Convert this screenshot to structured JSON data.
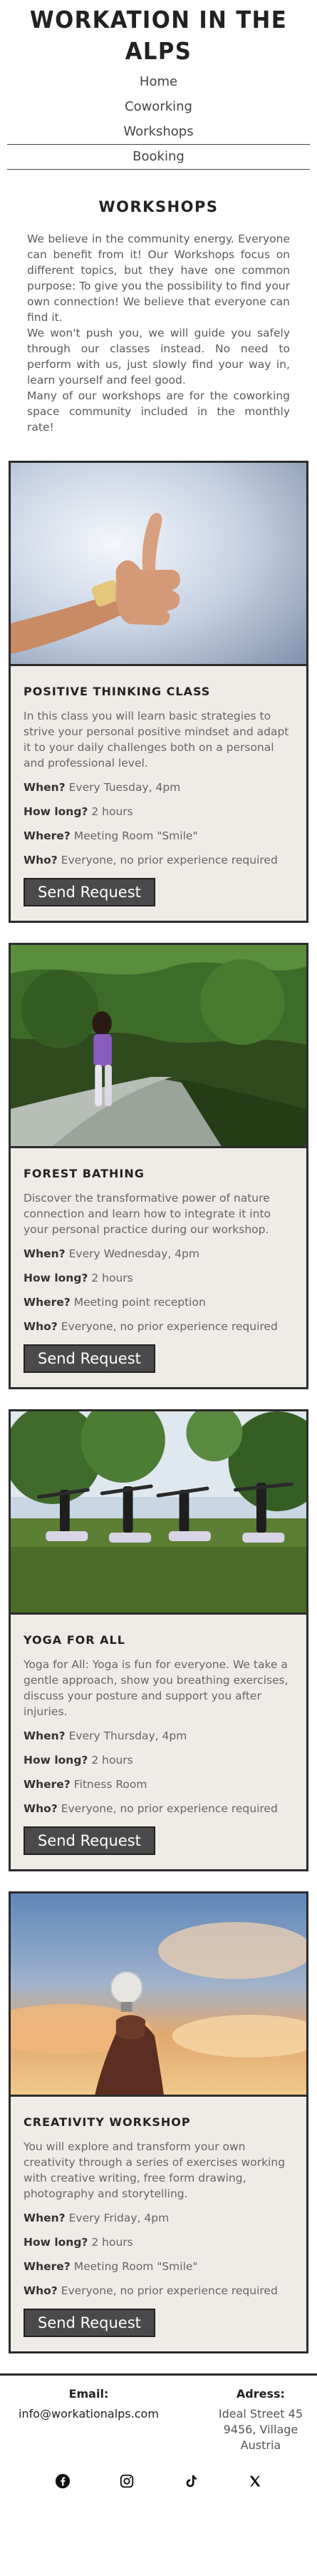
{
  "site": {
    "title": "WORKATION IN THE ALPS"
  },
  "nav": [
    "Home",
    "Coworking",
    "Workshops",
    "Booking"
  ],
  "intro": {
    "title": "WORKSHOPS",
    "paragraphs": [
      "We believe in the community energy. Everyone can benefit from it! Our Workshops focus on different topics, but they have one common purpose: To give you the possibility to find your own connection! We believe that everyone can find it.",
      "We won't push you, we will guide you safely through our classes instead. No need to perform with us, just slowly find your way in, learn yourself and feel good.",
      "Many of our workshops are for the coworking space community included in the monthly rate!"
    ]
  },
  "labels": {
    "when": "When?",
    "how_long": "How long?",
    "where": "Where?",
    "who": "Who?",
    "button": "Send Request"
  },
  "workshops": [
    {
      "title": "POSITIVE THINKING CLASS",
      "description": "In this class you will learn basic strategies to strive your personal positive mindset and adapt it to your daily challenges both on a personal and professional level.",
      "when": "Every Tuesday, 4pm",
      "how_long": "2 hours",
      "where": "Meeting Room \"Smile\"",
      "who": "Everyone, no prior experience required",
      "image": "thumbs-up-photo"
    },
    {
      "title": "FOREST BATHING",
      "description": "Discover the transformative power of nature connection and learn how to integrate it into your personal practice during our workshop.",
      "when": "Every Wednesday, 4pm",
      "how_long": "2 hours",
      "where": "Meeting point reception",
      "who": "Everyone, no prior experience required",
      "image": "forest-path-photo"
    },
    {
      "title": "YOGA FOR ALL",
      "description": "Yoga for All: Yoga is fun for everyone. We take a gentle approach, show you breathing exercises, discuss your posture and support you after injuries.",
      "when": "Every Thursday, 4pm",
      "how_long": "2 hours",
      "where": "Fitness Room",
      "who": "Everyone, no prior experience required",
      "image": "outdoor-yoga-photo"
    },
    {
      "title": "CREATIVITY WORKSHOP",
      "description": "You will explore and transform your own creativity through a series of exercises working with creative writing, free form drawing, photography and storytelling.",
      "when": "Every Friday, 4pm",
      "how_long": "2 hours",
      "where": "Meeting Room \"Smile\"",
      "who": "Everyone, no prior experience required",
      "image": "lightbulb-sky-photo"
    }
  ],
  "footer": {
    "email_label": "Email:",
    "email": "info@workationalps.com",
    "address_label": "Adress:",
    "address_lines": [
      "Ideal Street 45",
      "9456, Village",
      "Austria"
    ],
    "socials": [
      "facebook-icon",
      "instagram-icon",
      "tiktok-icon",
      "x-icon"
    ]
  }
}
